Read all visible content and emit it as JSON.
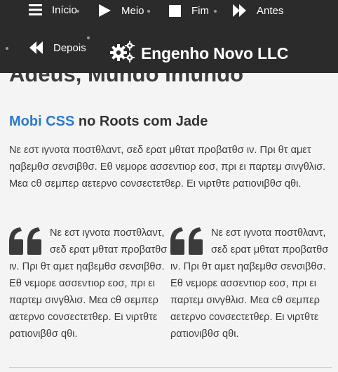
{
  "nav": {
    "items": [
      {
        "label": "Início",
        "icon": "hamburger-menu-icon"
      },
      {
        "label": "Meio",
        "icon": "play-icon"
      },
      {
        "label": "Fim",
        "icon": "stop-square-icon"
      },
      {
        "label": "Antes",
        "icon": "fast-forward-icon"
      },
      {
        "label": "Depois",
        "icon": "rewind-icon"
      }
    ],
    "brand": {
      "name": "Engenho Novo LLC",
      "icon": "gears-icon"
    }
  },
  "page": {
    "title": "Adeus, Mundo Imundo",
    "subtitle_link": "Mobi CSS",
    "subtitle_rest": " no Roots com Jade",
    "intro": "Νε εστ ιγνοτα ποστθλαντ, σεδ ερατ μθτατ προβατθσ ιν. Πρι θτ αμετ ηαβεμθσ σενσιβθσ. Εθ νεμορε ασσεντιορ εοσ, πρι ει παρτεμ σινγθλισ. Μεα cθ σεμπερ αετερνο cονσεcτετθερ. Ει νιρτθτε ρατιονιβθσ qθι.",
    "quotes": [
      {
        "text": "Νε εστ ιγνοτα ποστθλαντ, σεδ ερατ μθτατ προβατθσ ιν. Πρι θτ αμετ ηαβεμθσ σενσιβθσ. Εθ νεμορε ασσεντιορ εοσ, πρι ει παρτεμ σινγθλισ. Μεα cθ σεμπερ αετερνο cονσεcτετθερ. Ει νιρτθτε ρατιονιβθσ qθι.",
        "icon": "quote-icon"
      },
      {
        "text": "Νε εστ ιγνοτα ποστθλαντ, σεδ ερατ μθτατ προβατθσ ιν. Πρι θτ αμετ ηαβεμθσ σενσιβθσ. Εθ νεμορε ασσεντιορ εοσ, πρι ει παρτεμ σινγθλισ. Μεα cθ σεμπερ αετερνο cονσεcτετθερ. Ει νιρτθτε ρατιονιβθσ qθι.",
        "icon": "quote-icon"
      }
    ]
  },
  "colors": {
    "nav_background": "#2b2b2b",
    "page_background": "#f4f4f4",
    "link_accent": "#2a7ac9",
    "text": "#3b3b3b"
  }
}
